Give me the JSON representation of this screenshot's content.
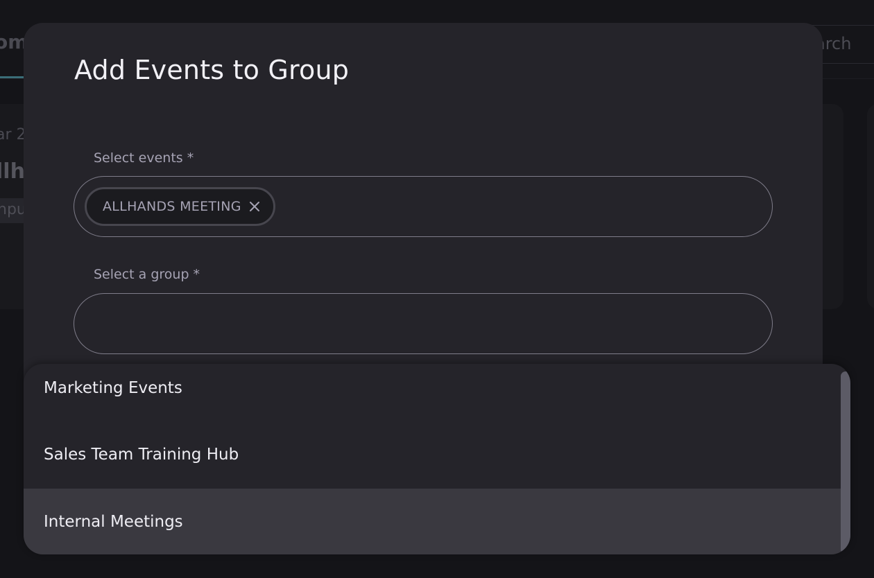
{
  "background": {
    "tab_label": "om",
    "search_placeholder": "arch",
    "event_date": "ar 2",
    "event_name": "llh",
    "event_chip": "npu"
  },
  "dialog": {
    "title": "Add Events to Group",
    "events_field": {
      "label": "Select events *",
      "selected_chips": [
        {
          "label": "ALLHANDS MEETING"
        }
      ]
    },
    "group_field": {
      "label": "Select a group *",
      "value": ""
    }
  },
  "group_menu": {
    "options": [
      {
        "label": "Marketing Events",
        "highlighted": false
      },
      {
        "label": "Sales Team Training Hub",
        "highlighted": false
      },
      {
        "label": "Internal Meetings",
        "highlighted": true
      }
    ]
  },
  "icons": {
    "chip_remove": "close-icon"
  },
  "colors": {
    "dialog_bg": "#25242a",
    "highlight_bg": "#3a3940",
    "label_text": "#a6a3b4",
    "field_border": "#7f7d8a"
  }
}
